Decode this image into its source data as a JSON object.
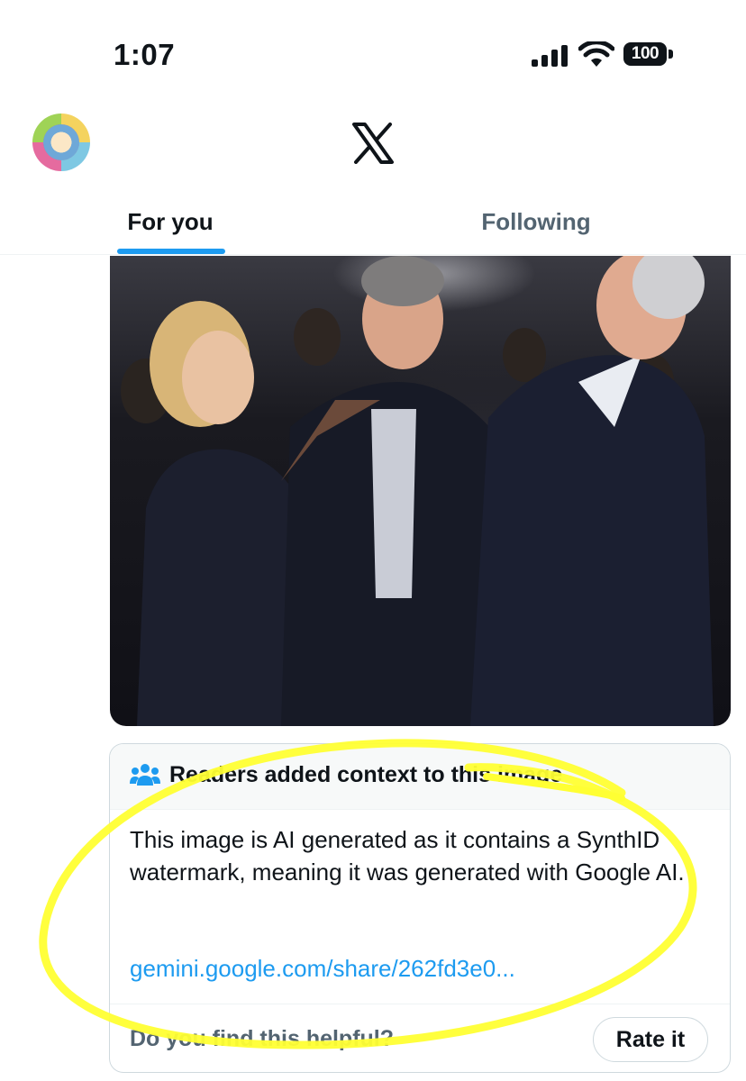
{
  "status_bar": {
    "time": "1:07",
    "battery": "100",
    "icons": [
      "signal-icon",
      "wifi-icon",
      "battery-icon"
    ]
  },
  "header": {
    "logo": "X",
    "avatar_icon": "avatar"
  },
  "tabs": [
    {
      "label": "For you",
      "selected": true
    },
    {
      "label": "Following",
      "selected": false
    }
  ],
  "post": {
    "image_icon": "photo"
  },
  "community_note": {
    "title": "Readers added context to this image",
    "body": "This image is AI generated as it contains a SynthID watermark, meaning it was generated with Google AI.",
    "link": "gemini.google.com/share/262fd3e0...",
    "helpful_prompt": "Do you find this helpful?",
    "rate_label": "Rate it"
  },
  "colors": {
    "accent": "#1d9bf0",
    "text": "#0f1419",
    "muted": "#536471",
    "highlight": "#ffff33"
  }
}
